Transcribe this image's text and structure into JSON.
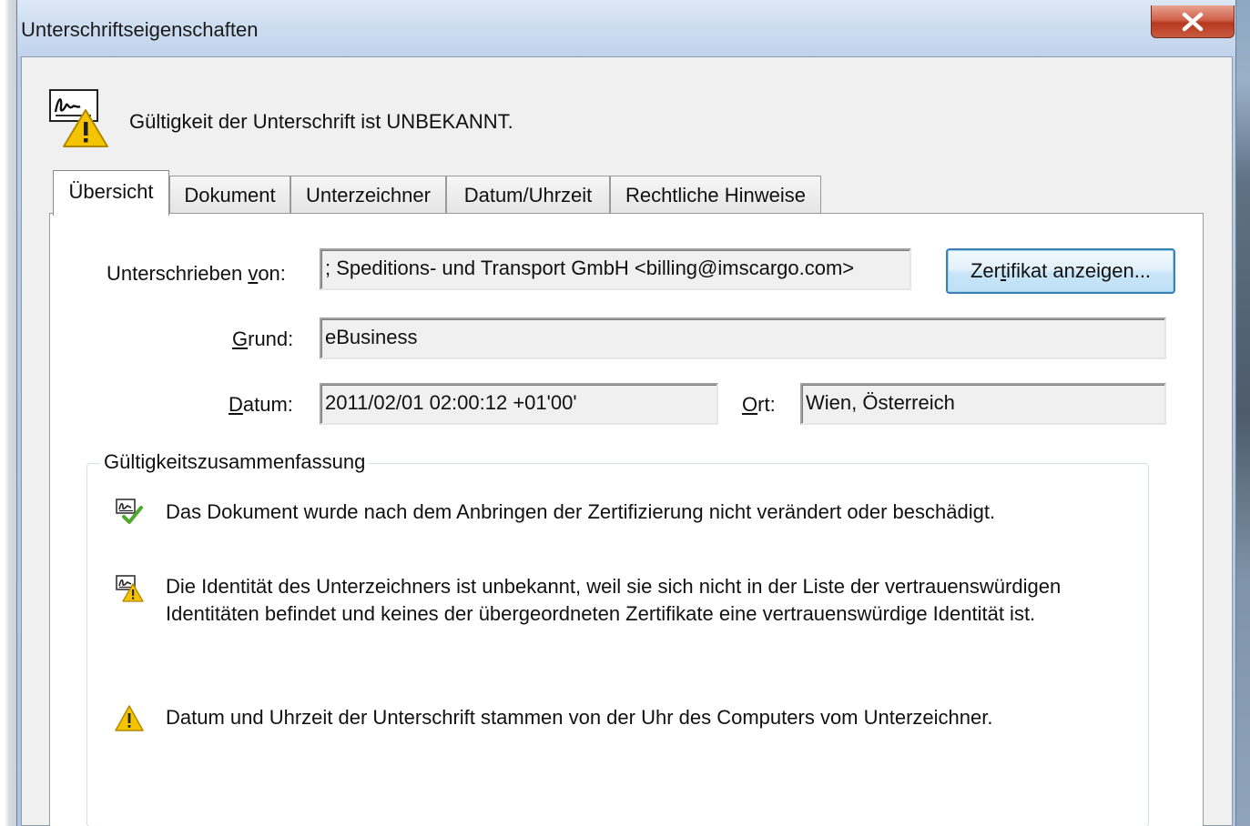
{
  "window": {
    "title": "Unterschriftseigenschaften",
    "close_symbol": "✕"
  },
  "header": {
    "icon": "signature-warning-icon",
    "text": "Gültigkeit der Unterschrift ist UNBEKANNT."
  },
  "tabs": [
    {
      "label": "Übersicht",
      "active": true
    },
    {
      "label": "Dokument",
      "active": false
    },
    {
      "label": "Unterzeichner",
      "active": false
    },
    {
      "label": "Datum/Uhrzeit",
      "active": false
    },
    {
      "label": "Rechtliche Hinweise",
      "active": false
    }
  ],
  "fields": {
    "signed_by": {
      "label": "Unterschrieben von:",
      "value": "; Speditions- und Transport GmbH <billing@imscargo.com>"
    },
    "reason": {
      "label": "Grund:",
      "value": "eBusiness"
    },
    "date": {
      "label": "Datum:",
      "value": "2011/02/01 02:00:12 +01'00'"
    },
    "location": {
      "label": "Ort:",
      "value": "Wien, Österreich"
    }
  },
  "buttons": {
    "show_certificate": "Zertifikat anzeigen..."
  },
  "validity_summary": {
    "title": "Gültigkeitszusammenfassung",
    "items": [
      {
        "icon": "document-valid-icon",
        "text": "Das Dokument wurde nach dem Anbringen der Zertifizierung nicht verändert oder beschädigt."
      },
      {
        "icon": "identity-warning-icon",
        "text": "Die Identität des Unterzeichners ist unbekannt, weil sie sich nicht in der Liste der vertrauenswürdigen Identitäten befindet und keines der übergeordneten Zertifikate eine vertrauenswürdige Identität ist."
      },
      {
        "icon": "warning-icon",
        "text": "Datum und Uhrzeit der Unterschrift stammen von der Uhr des Computers vom Unterzeichner."
      }
    ]
  },
  "colors": {
    "warning": "#f5c400",
    "valid_green": "#4fa82c",
    "button_border": "#3c7fb1",
    "close_red": "#c4452b"
  }
}
